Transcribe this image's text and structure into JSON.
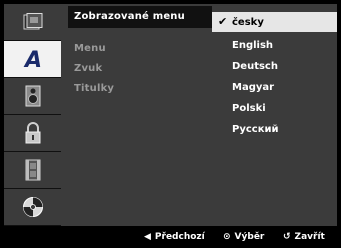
{
  "sidebar_icons": [
    {
      "name": "disc-info-icon",
      "active": false
    },
    {
      "name": "language-a-icon",
      "active": true
    },
    {
      "name": "speaker-icon",
      "active": false
    },
    {
      "name": "lock-icon",
      "active": false
    },
    {
      "name": "film-strip-icon",
      "active": false
    },
    {
      "name": "disc-icon",
      "active": false
    }
  ],
  "menu": {
    "items": [
      "Zobrazované menu",
      "Menu",
      "Zvuk",
      "Titulky"
    ],
    "active_index": 0
  },
  "options": {
    "items": [
      "česky",
      "English",
      "Deutsch",
      "Magyar",
      "Polski",
      "Русский"
    ],
    "selected_index": 0
  },
  "footer": {
    "back_label": "Předchozí",
    "select_label": "Výběr",
    "close_label": "Zavřít",
    "back_icon": "left-triangle-icon",
    "select_icon": "circle-select-icon",
    "close_icon": "return-icon"
  },
  "colors": {
    "panel": "#3b3b3b",
    "active_row": "#111111",
    "selected_option": "#e6e6e6",
    "active_icon": "#f2f2f2"
  }
}
